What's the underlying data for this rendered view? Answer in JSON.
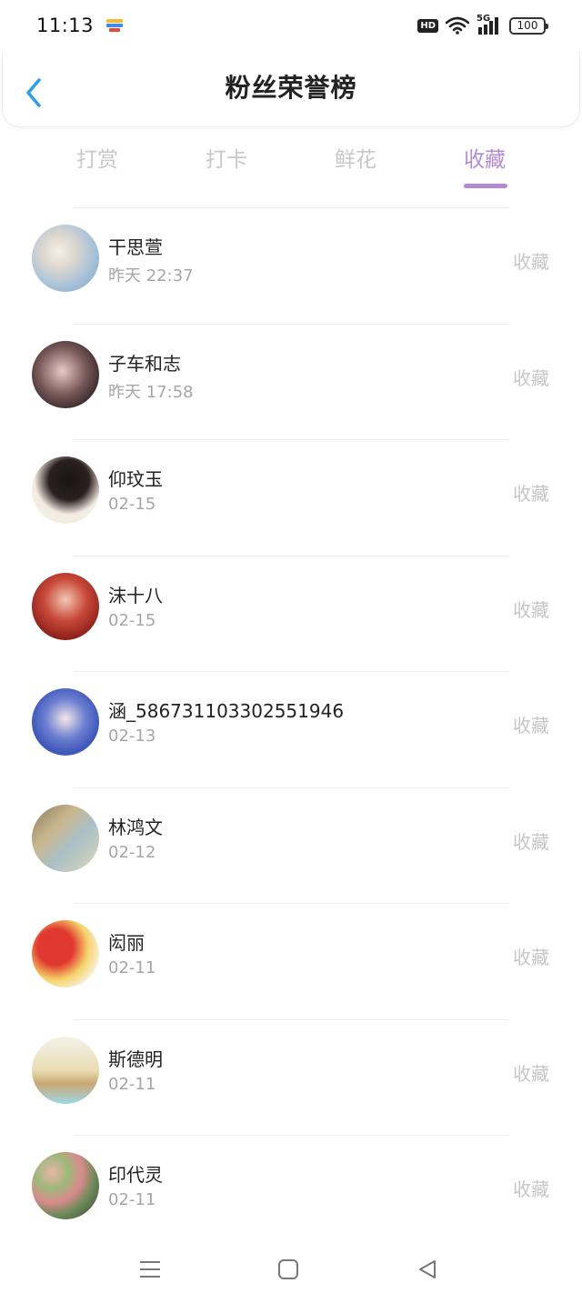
{
  "status_bar": {
    "time": "11:13",
    "hd": "HD",
    "network": "5G",
    "battery": "100"
  },
  "header": {
    "title": "粉丝荣誉榜",
    "back_icon": "chevron-left-icon"
  },
  "tabs": [
    {
      "label": "打赏",
      "active": false
    },
    {
      "label": "打卡",
      "active": false
    },
    {
      "label": "鲜花",
      "active": false
    },
    {
      "label": "收藏",
      "active": true
    }
  ],
  "accent_color": "#b48ad8",
  "fans": [
    {
      "name": "干思萱",
      "time": "昨天 22:37",
      "action": "收藏"
    },
    {
      "name": "子车和志",
      "time": "昨天 17:58",
      "action": "收藏"
    },
    {
      "name": "仰玟玉",
      "time": "02-15",
      "action": "收藏"
    },
    {
      "name": "沫十八",
      "time": "02-15",
      "action": "收藏"
    },
    {
      "name": "涵_586731103302551946",
      "time": "02-13",
      "action": "收藏"
    },
    {
      "name": "林鸿文",
      "time": "02-12",
      "action": "收藏"
    },
    {
      "name": "闳丽",
      "time": "02-11",
      "action": "收藏"
    },
    {
      "name": "斯德明",
      "time": "02-11",
      "action": "收藏"
    },
    {
      "name": "印代灵",
      "time": "02-11",
      "action": "收藏"
    }
  ],
  "nav_bar": [
    "menu-icon",
    "home-icon",
    "back-triangle-icon"
  ]
}
